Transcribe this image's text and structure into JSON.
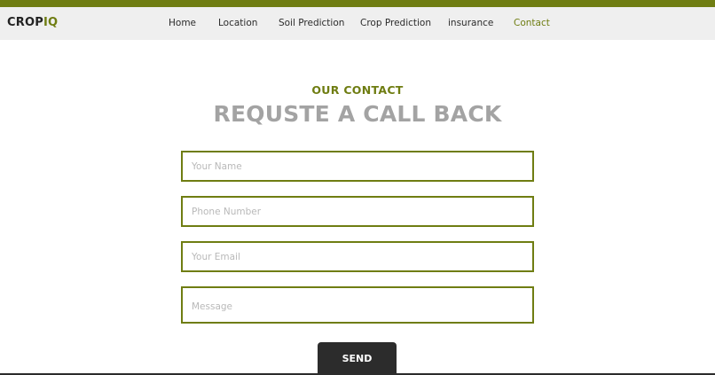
{
  "brand": {
    "logo_part1": "CROP",
    "logo_part2": "IQ",
    "accent_color": "#6f7d12"
  },
  "nav": {
    "items": [
      {
        "label": "Home",
        "active": false
      },
      {
        "label": "Location",
        "active": false
      },
      {
        "label": "Soil Prediction",
        "active": false
      },
      {
        "label": "Crop Prediction",
        "active": false
      },
      {
        "label": "insurance",
        "active": false
      },
      {
        "label": "Contact",
        "active": true
      }
    ]
  },
  "contact": {
    "kicker": "OUR CONTACT",
    "title": "REQUSTE A CALL BACK"
  },
  "form": {
    "name_placeholder": "Your Name",
    "phone_placeholder": "Phone Number",
    "email_placeholder": "Your Email",
    "message_placeholder": "Message",
    "send_label": "SEND"
  }
}
